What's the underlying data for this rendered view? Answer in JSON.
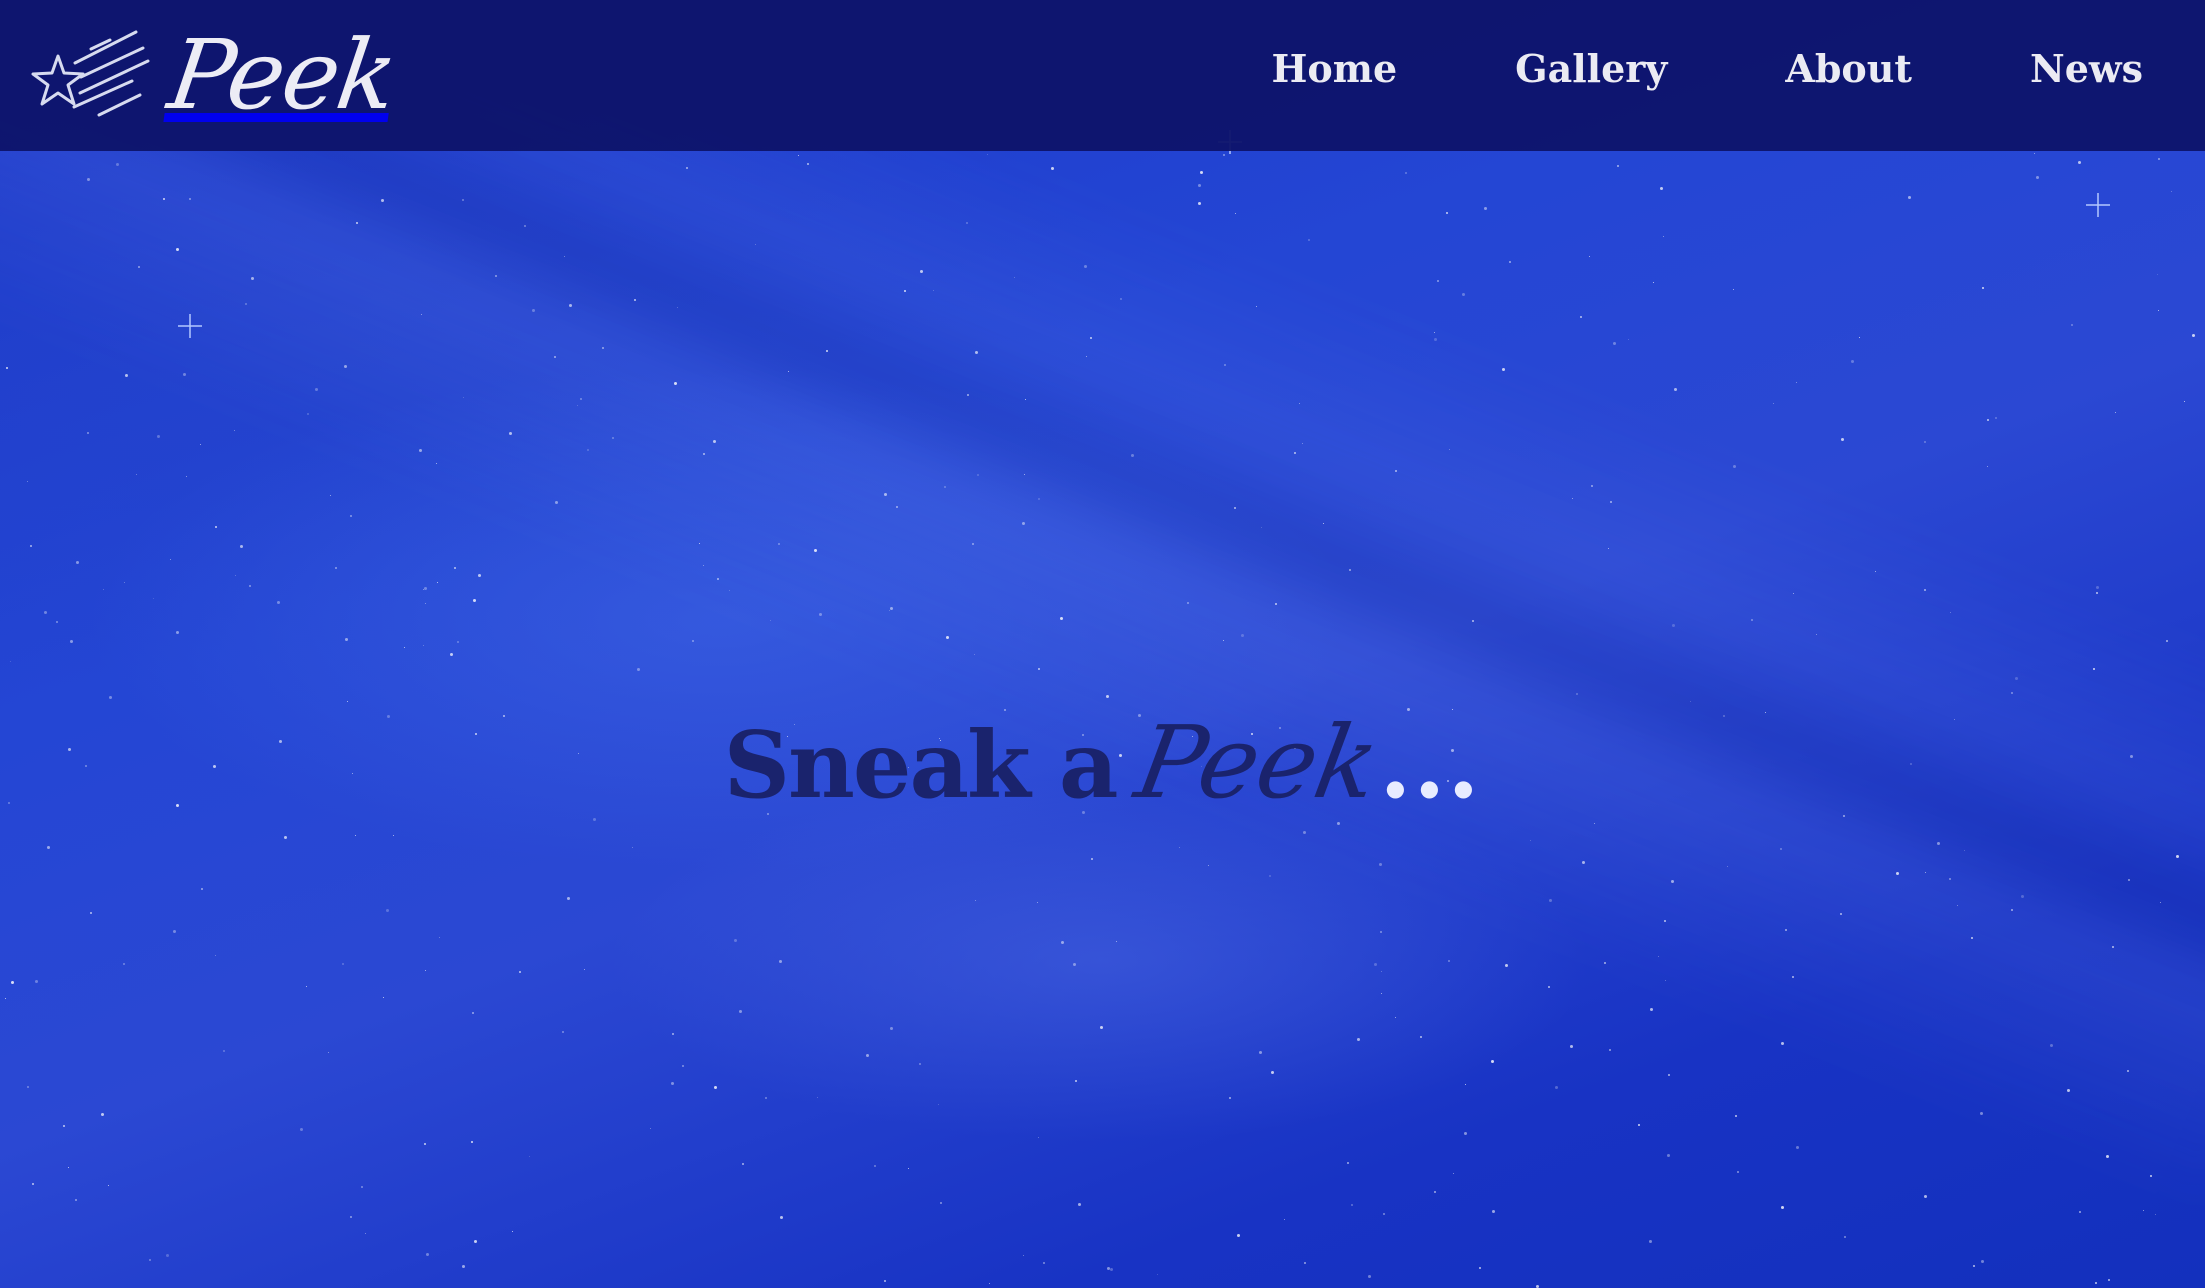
{
  "site": {
    "brand_name": "Peek",
    "brand_icon": "shooting-star-icon"
  },
  "nav": {
    "items": [
      {
        "label": "Home"
      },
      {
        "label": "Gallery"
      },
      {
        "label": "About"
      },
      {
        "label": "News"
      }
    ]
  },
  "hero": {
    "headline_prefix": "Sneak a",
    "headline_brand": "Peek",
    "headline_suffix": "..."
  },
  "colors": {
    "navbar_background": "#0e146b",
    "hero_background": "#1a33c7",
    "nav_text": "#ebebf3",
    "headline_text": "#1a236d",
    "ellipsis_text": "#e8ecff"
  }
}
